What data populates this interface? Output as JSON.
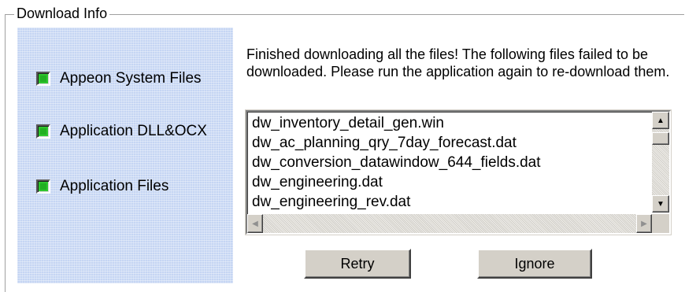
{
  "group_title": "Download Info",
  "status_items": [
    {
      "label": "Appeon System Files",
      "state": "complete",
      "color": "#22b022"
    },
    {
      "label": "Application DLL&OCX",
      "state": "complete",
      "color": "#22b022"
    },
    {
      "label": "Application Files",
      "state": "complete",
      "color": "#22b022"
    }
  ],
  "message": "Finished downloading all the files! The following files failed to be downloaded. Please run the application again to re-download them.",
  "failed_files": [
    "dw_inventory_detail_gen.win",
    "dw_ac_planning_qry_7day_forecast.dat",
    "dw_conversion_datawindow_644_fields.dat",
    "dw_engineering.dat",
    "dw_engineering_rev.dat"
  ],
  "buttons": {
    "retry": "Retry",
    "ignore": "Ignore"
  },
  "panel_color": "#c5d5f3"
}
